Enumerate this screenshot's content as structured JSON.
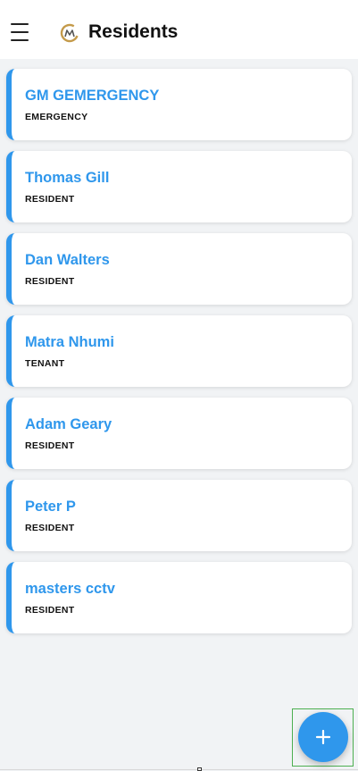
{
  "header": {
    "title": "Residents",
    "menu_icon": "hamburger-menu-icon",
    "logo_icon": "gm-logo-icon"
  },
  "residents": [
    {
      "name": "GM GEMERGENCY",
      "role": "EMERGENCY"
    },
    {
      "name": "Thomas Gill",
      "role": "RESIDENT"
    },
    {
      "name": "Dan Walters",
      "role": "RESIDENT"
    },
    {
      "name": "Matra Nhumi",
      "role": "TENANT"
    },
    {
      "name": "Adam Geary",
      "role": "RESIDENT"
    },
    {
      "name": "Peter P",
      "role": "RESIDENT"
    },
    {
      "name": "masters cctv",
      "role": "RESIDENT"
    }
  ],
  "fab": {
    "icon": "plus-icon"
  },
  "colors": {
    "accent": "#2f97ec",
    "background": "#f1f3f5",
    "card": "#ffffff"
  }
}
